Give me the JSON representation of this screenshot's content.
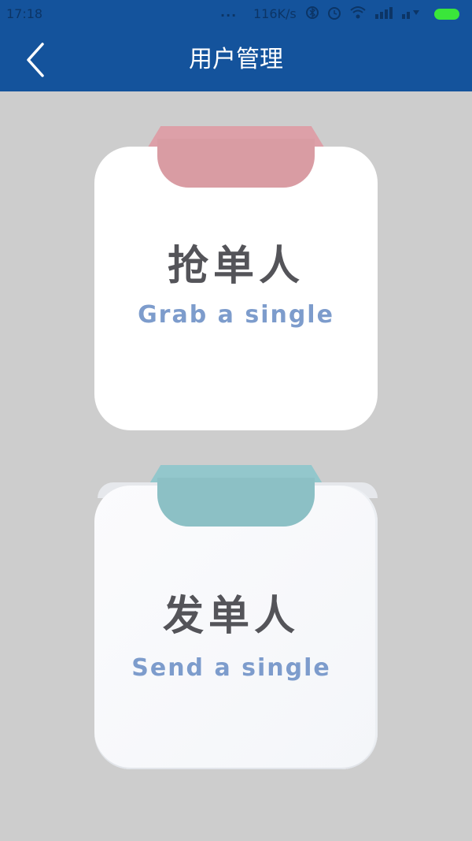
{
  "status_bar": {
    "time": "17:18",
    "dots": "...",
    "network_speed": "116K/s"
  },
  "header": {
    "title": "用户管理"
  },
  "cards": [
    {
      "title": "抢单人",
      "subtitle": "Grab a single",
      "tab_color": "#d99ca3",
      "tab_back_color": "#dda0a8"
    },
    {
      "title": "发单人",
      "subtitle": "Send a single",
      "tab_color": "#8cc0c5",
      "tab_back_color": "#93c7cc"
    }
  ],
  "colors": {
    "header_bg": "#14539c",
    "page_bg": "#cdcdcd",
    "title_text": "#545459",
    "subtitle_text": "#7d9ccc"
  }
}
